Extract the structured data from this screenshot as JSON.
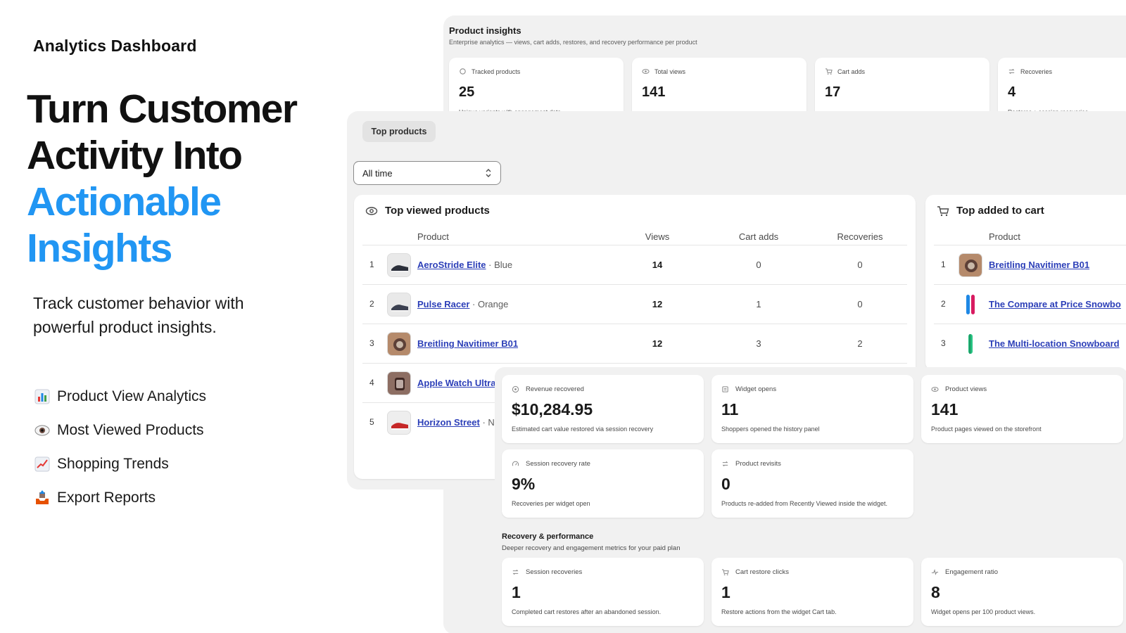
{
  "brand": "Analytics Dashboard",
  "headline": {
    "line1": "Turn Customer",
    "line2": "Activity Into",
    "accent1": "Actionable",
    "accent2": "Insights"
  },
  "subtext": "Track customer behavior with powerful product insights.",
  "features": [
    {
      "icon": "bar-chart-icon",
      "label": "Product View Analytics"
    },
    {
      "icon": "eye-icon",
      "label": "Most Viewed Products"
    },
    {
      "icon": "trend-chart-icon",
      "label": "Shopping Trends"
    },
    {
      "icon": "outbox-tray-icon",
      "label": "Export Reports"
    }
  ],
  "product_insights": {
    "title": "Product insights",
    "subtitle": "Enterprise analytics — views, cart adds, restores, and recovery performance per product",
    "stats": [
      {
        "icon": "tag-icon",
        "label": "Tracked products",
        "value": "25",
        "desc": "Unique variants with engagement data"
      },
      {
        "icon": "eye-icon",
        "label": "Total views",
        "value": "141",
        "desc": ""
      },
      {
        "icon": "cart-icon",
        "label": "Cart adds",
        "value": "17",
        "desc": ""
      },
      {
        "icon": "refresh-icon",
        "label": "Recoveries",
        "value": "4",
        "desc": "Restores + session recoveries"
      }
    ]
  },
  "tabs": {
    "top_products": "Top products"
  },
  "range_select": {
    "value": "All time"
  },
  "top_viewed": {
    "title": "Top viewed products",
    "columns": {
      "product": "Product",
      "views": "Views",
      "cart_adds": "Cart adds",
      "recoveries": "Recoveries"
    },
    "rows": [
      {
        "rank": "1",
        "name": "AeroStride Elite",
        "variant": " · Blue",
        "views": "14",
        "cart_adds": "0",
        "recoveries": "0"
      },
      {
        "rank": "2",
        "name": "Pulse Racer",
        "variant": " · Orange",
        "views": "12",
        "cart_adds": "1",
        "recoveries": "0"
      },
      {
        "rank": "3",
        "name": "Breitling Navitimer B01",
        "variant": "",
        "views": "12",
        "cart_adds": "3",
        "recoveries": "2"
      },
      {
        "rank": "4",
        "name": "Apple Watch Ultra",
        "variant": "",
        "views": "",
        "cart_adds": "",
        "recoveries": ""
      },
      {
        "rank": "5",
        "name": "Horizon Street",
        "variant": " · N",
        "views": "",
        "cart_adds": "",
        "recoveries": ""
      }
    ]
  },
  "top_added": {
    "title": "Top added to cart",
    "columns": {
      "product": "Product"
    },
    "rows": [
      {
        "rank": "1",
        "name": "Breitling Navitimer B01"
      },
      {
        "rank": "2",
        "name": "The Compare at Price Snowbo"
      },
      {
        "rank": "3",
        "name": "The Multi-location Snowboard"
      }
    ]
  },
  "metrics": [
    {
      "icon": "coin-icon",
      "label": "Revenue recovered",
      "value": "$10,284.95",
      "desc": "Estimated cart value restored via session recovery"
    },
    {
      "icon": "list-icon",
      "label": "Widget opens",
      "value": "11",
      "desc": "Shoppers opened the history panel"
    },
    {
      "icon": "eye-icon",
      "label": "Product views",
      "value": "141",
      "desc": "Product pages viewed on the storefront"
    },
    {
      "icon": "gauge-icon",
      "label": "Session recovery rate",
      "value": "9%",
      "desc": "Recoveries per widget open"
    },
    {
      "icon": "refresh-icon",
      "label": "Product revisits",
      "value": "0",
      "desc": "Products re-added from Recently Viewed inside the widget."
    }
  ],
  "recovery_performance": {
    "title": "Recovery & performance",
    "subtitle": "Deeper recovery and engagement metrics for your paid plan",
    "metrics": [
      {
        "icon": "refresh-icon",
        "label": "Session recoveries",
        "value": "1",
        "desc": "Completed cart restores after an abandoned session."
      },
      {
        "icon": "cart-icon",
        "label": "Cart restore clicks",
        "value": "1",
        "desc": "Restore actions from the widget Cart tab."
      },
      {
        "icon": "pulse-icon",
        "label": "Engagement ratio",
        "value": "8",
        "desc": "Widget opens per 100 product views."
      }
    ]
  },
  "colors": {
    "accent": "#2196f3",
    "link": "#2c3fb8",
    "panel": "#f1f1f1"
  }
}
